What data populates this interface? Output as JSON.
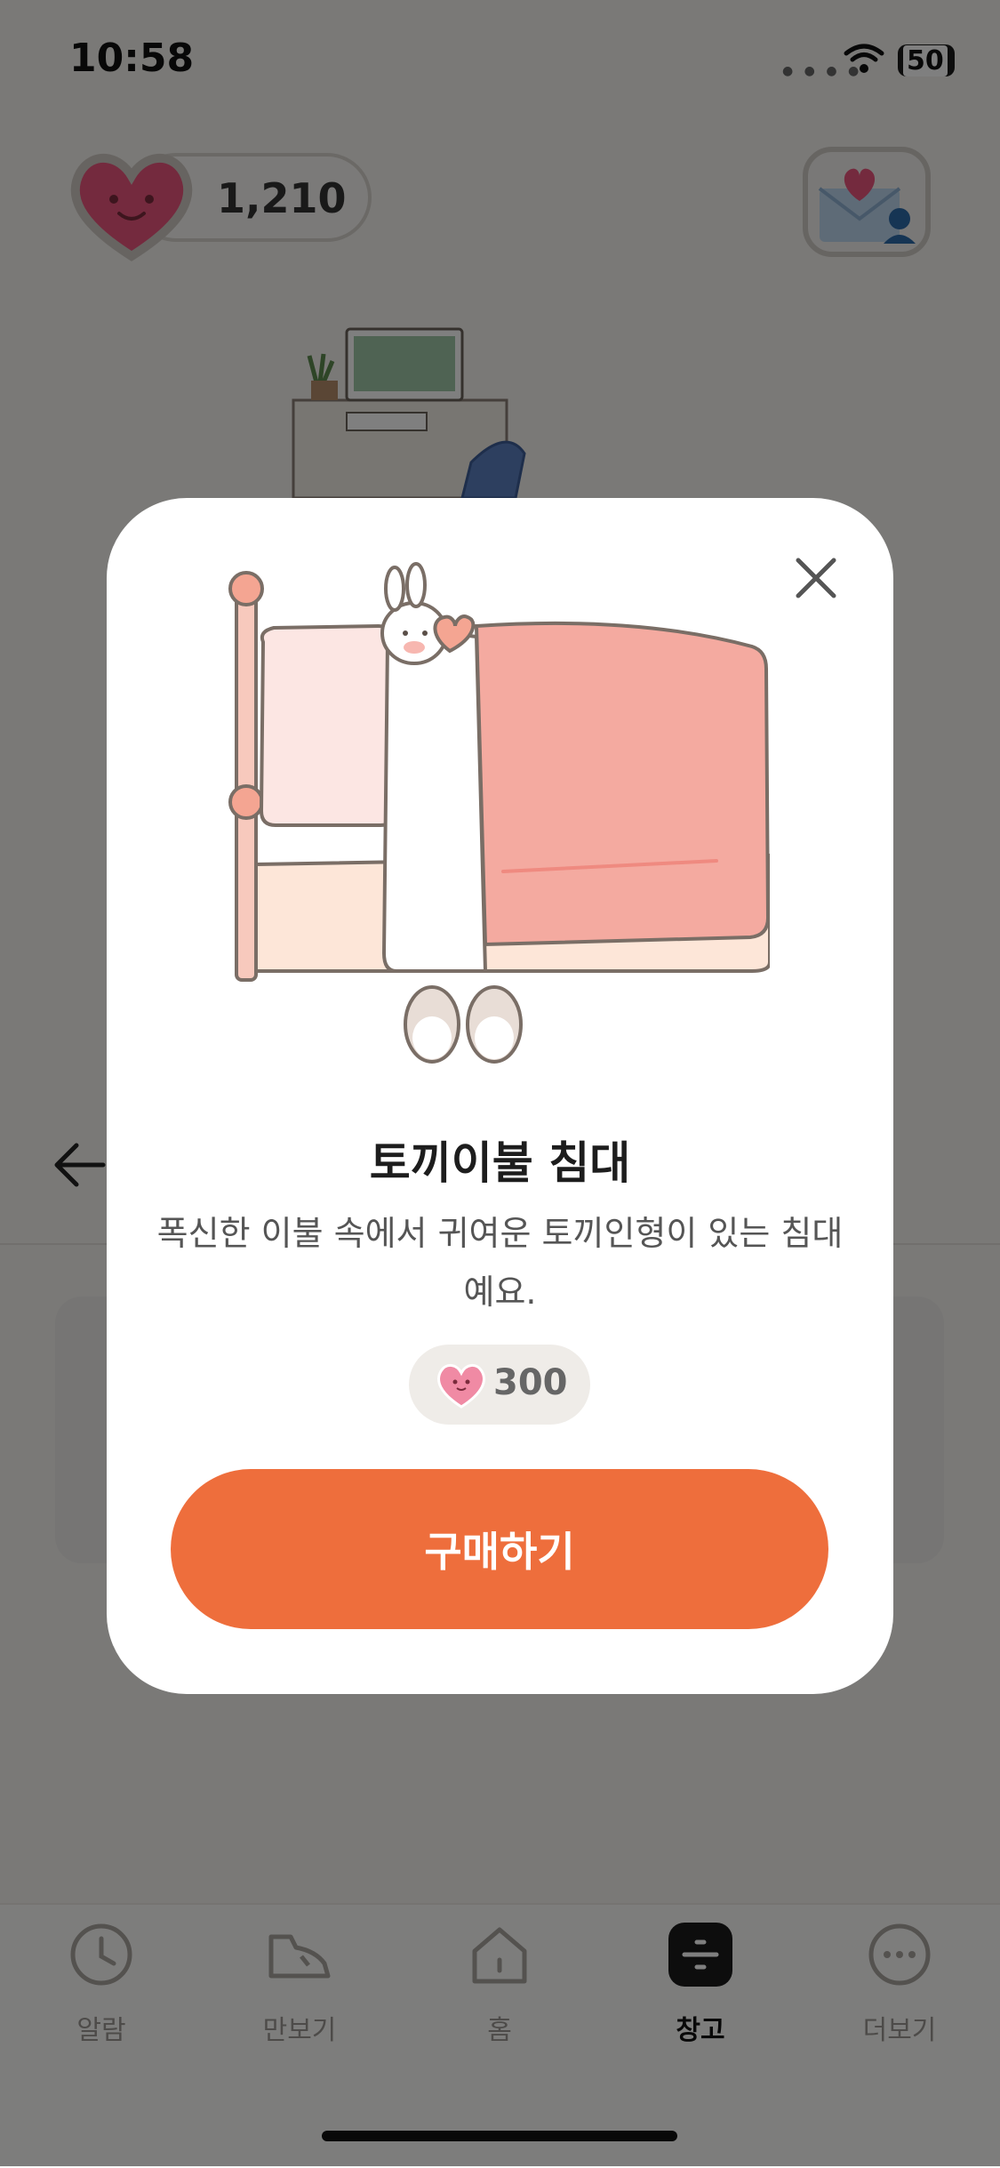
{
  "status_bar": {
    "time": "10:58",
    "battery": "50"
  },
  "header": {
    "heart_count": "1,210"
  },
  "tabs": [
    {
      "label": "알람",
      "icon": "clock-icon",
      "active": false
    },
    {
      "label": "만보기",
      "icon": "sneaker-icon",
      "active": false
    },
    {
      "label": "홈",
      "icon": "house-icon",
      "active": false
    },
    {
      "label": "창고",
      "icon": "storage-icon",
      "active": true
    },
    {
      "label": "더보기",
      "icon": "more-dots-icon",
      "active": false
    }
  ],
  "modal": {
    "title": "토끼이불 침대",
    "description": "폭신한 이불 속에서 귀여운 토끼인형이 있는 침대예요.",
    "price": "300",
    "buy_label": "구매하기",
    "close_icon": "close-icon",
    "illustration": "bunny-bed-illustration"
  },
  "colors": {
    "accent": "#ee6e3c",
    "overlay": "rgba(0,0,0,0.5)",
    "heart": "#f08aa4",
    "blanket": "#f4aaa0"
  }
}
